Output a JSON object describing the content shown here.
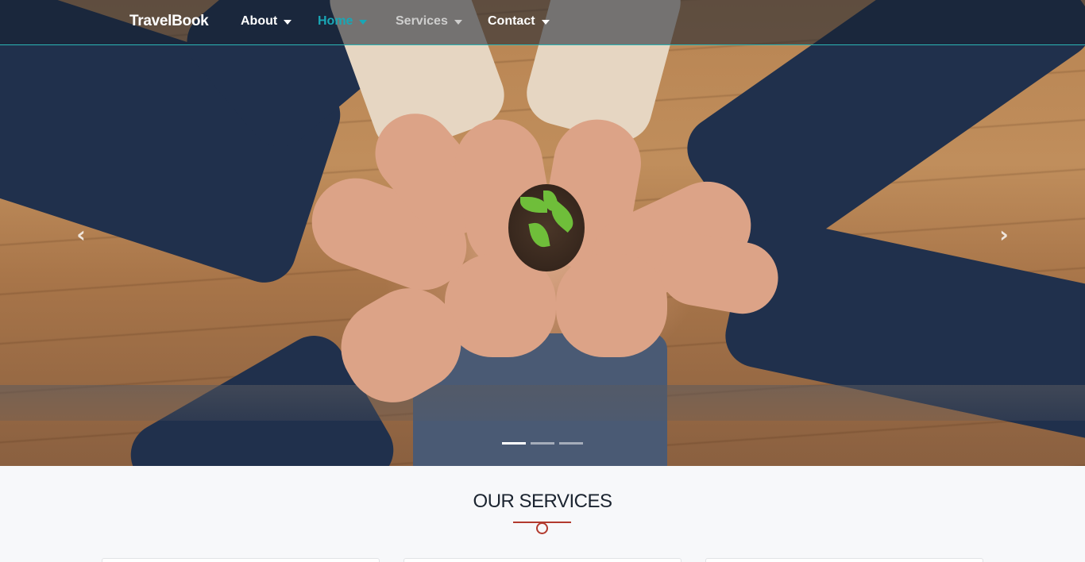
{
  "brand": "TravelBook",
  "nav": {
    "items": [
      {
        "label": "About",
        "active": false
      },
      {
        "label": "Home",
        "active": true
      },
      {
        "label": "Services",
        "active": false
      },
      {
        "label": "Contact",
        "active": false
      }
    ]
  },
  "hero": {
    "image_description": "",
    "carousel": {
      "prev_icon": "chevron-left-icon",
      "next_icon": "chevron-right-icon",
      "slides_count": 3,
      "active_index": 0
    }
  },
  "services": {
    "title": "OUR SERVICES"
  },
  "colors": {
    "accent": "#19a7b6",
    "divider": "#b23a2e",
    "background": "#f7f8fa",
    "title": "#1b2430"
  }
}
